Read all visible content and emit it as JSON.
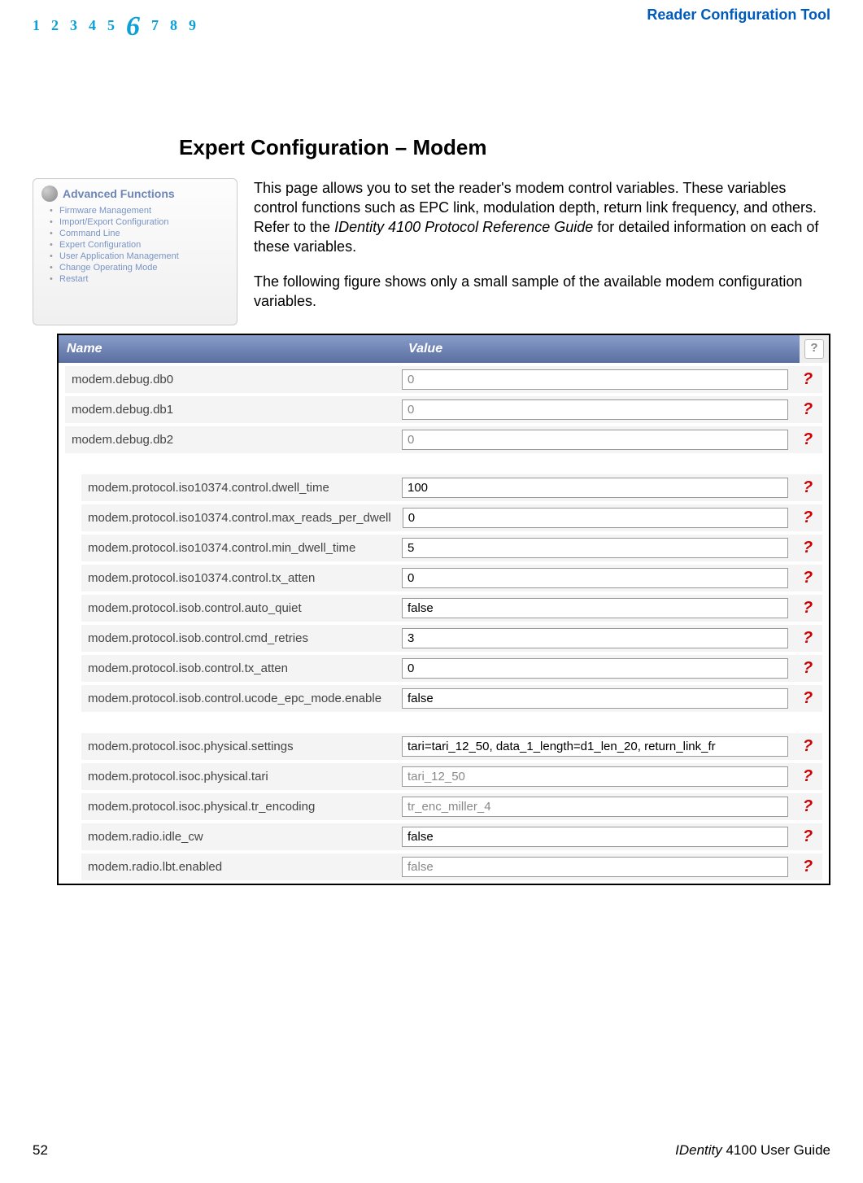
{
  "header": {
    "chapter_numbers": [
      "1",
      "2",
      "3",
      "4",
      "5",
      "6",
      "7",
      "8",
      "9"
    ],
    "current_chapter": "6",
    "right_title": "Reader Configuration Tool"
  },
  "sidebar": {
    "title": "Advanced Functions",
    "items": [
      "Firmware Management",
      "Import/Export Configuration",
      "Command Line",
      "Expert Configuration",
      "User Application Management",
      "Change Operating Mode",
      "Restart"
    ]
  },
  "section": {
    "title": "Expert Configuration – Modem",
    "para1_a": "This page allows you to set the reader's modem control variables. These variables control functions such as EPC link, modulation depth, return link frequency, and others. Refer to the ",
    "para1_ref": "IDentity 4100 Protocol Reference Guide",
    "para1_b": " for detailed information on each of these variables.",
    "para2": "The following figure shows only a small sample of the available modem configuration variables."
  },
  "config_table": {
    "columns": {
      "name": "Name",
      "value": "Value",
      "help": "?"
    },
    "groups": [
      {
        "indent": false,
        "rows": [
          {
            "name": "modem.debug.db0",
            "value": "0",
            "disabled": true
          },
          {
            "name": "modem.debug.db1",
            "value": "0",
            "disabled": true
          },
          {
            "name": "modem.debug.db2",
            "value": "0",
            "disabled": true
          }
        ]
      },
      {
        "indent": true,
        "rows": [
          {
            "name": "modem.protocol.iso10374.control.dwell_time",
            "value": "100",
            "disabled": false
          },
          {
            "name": "modem.protocol.iso10374.control.max_reads_per_dwell",
            "value": "0",
            "disabled": false
          },
          {
            "name": "modem.protocol.iso10374.control.min_dwell_time",
            "value": "5",
            "disabled": false
          },
          {
            "name": "modem.protocol.iso10374.control.tx_atten",
            "value": "0",
            "disabled": false
          },
          {
            "name": "modem.protocol.isob.control.auto_quiet",
            "value": "false",
            "disabled": false
          },
          {
            "name": "modem.protocol.isob.control.cmd_retries",
            "value": "3",
            "disabled": false
          },
          {
            "name": "modem.protocol.isob.control.tx_atten",
            "value": "0",
            "disabled": false
          },
          {
            "name": "modem.protocol.isob.control.ucode_epc_mode.enable",
            "value": "false",
            "disabled": false
          }
        ]
      },
      {
        "indent": true,
        "rows": [
          {
            "name": "modem.protocol.isoc.physical.settings",
            "value": "tari=tari_12_50, data_1_length=d1_len_20, return_link_fr",
            "disabled": false
          },
          {
            "name": "modem.protocol.isoc.physical.tari",
            "value": "tari_12_50",
            "disabled": true
          },
          {
            "name": "modem.protocol.isoc.physical.tr_encoding",
            "value": "tr_enc_miller_4",
            "disabled": true
          },
          {
            "name": "modem.radio.idle_cw",
            "value": "false",
            "disabled": false
          },
          {
            "name": "modem.radio.lbt.enabled",
            "value": "false",
            "disabled": true
          }
        ]
      }
    ]
  },
  "footer": {
    "page_number": "52",
    "guide_italic": "IDentity",
    "guide_rest": " 4100 User Guide"
  }
}
